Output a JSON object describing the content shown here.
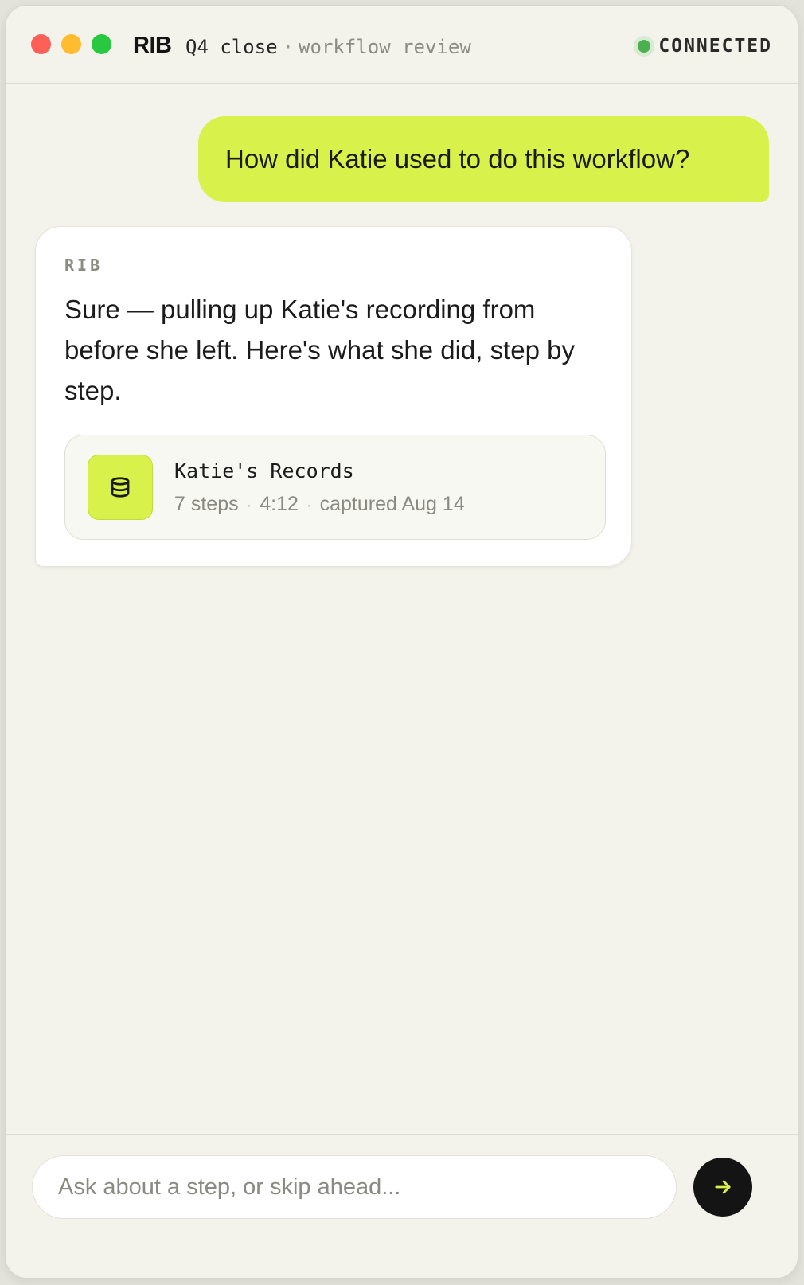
{
  "window": {
    "brand": "RIB",
    "title": "Q4 close",
    "title_separator": "·",
    "subtitle": "workflow review",
    "status": "CONNECTED",
    "status_color": "#4caf50"
  },
  "messages": {
    "user": {
      "text": "How did Katie used to do this workflow?"
    },
    "assistant": {
      "sender": "RIB",
      "text": "Sure — pulling up Katie's recording from before she left. Here's what she did, step by step.",
      "attachment": {
        "icon": "database-icon",
        "title": "Katie's Records",
        "steps": "7 steps",
        "duration": "4:12",
        "captured": "captured Aug 14",
        "separator": "·"
      }
    }
  },
  "composer": {
    "placeholder": "Ask about a step, or skip ahead...",
    "send_icon": "arrow-right-icon"
  },
  "colors": {
    "accent": "#d8f14b",
    "background": "#f3f3ec",
    "send_button": "#141414"
  }
}
